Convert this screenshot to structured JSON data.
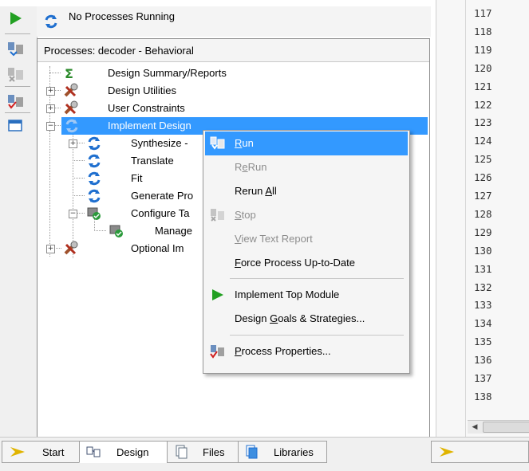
{
  "status": {
    "text": "No Processes Running"
  },
  "processes": {
    "title": "Processes: decoder - Behavioral",
    "tree": [
      {
        "label": "Design Summary/Reports",
        "icon": "sigma-icon"
      },
      {
        "label": "Design Utilities",
        "icon": "tools-icon"
      },
      {
        "label": "User Constraints",
        "icon": "tools-icon"
      },
      {
        "label": "Implement Design",
        "icon": "process-arrows-icon",
        "selected": true
      },
      {
        "label": "Synthesize -",
        "icon": "process-arrows-icon"
      },
      {
        "label": "Translate",
        "icon": "process-arrows-icon"
      },
      {
        "label": "Fit",
        "icon": "process-arrows-icon"
      },
      {
        "label": "Generate Pro",
        "icon": "process-arrows-icon"
      },
      {
        "label": "Configure Ta",
        "icon": "device-config-icon"
      },
      {
        "label": "Manage",
        "icon": "device-config-icon"
      },
      {
        "label": "Optional Im",
        "icon": "tools-icon"
      }
    ]
  },
  "context_menu": {
    "items": [
      {
        "pre": "",
        "key": "R",
        "post": "un",
        "state": "highlight"
      },
      {
        "pre": "R",
        "key": "e",
        "post": "Run",
        "state": "disabled"
      },
      {
        "pre": "Rerun ",
        "key": "A",
        "post": "ll",
        "state": "enabled"
      },
      {
        "pre": "",
        "key": "S",
        "post": "top",
        "state": "disabled"
      },
      {
        "pre": "",
        "key": "V",
        "post": "iew Text Report",
        "state": "disabled"
      },
      {
        "pre": "",
        "key": "F",
        "post": "orce Process Up-to-Date",
        "state": "enabled"
      },
      {
        "pre": "Implement Top Module",
        "key": "",
        "post": "",
        "state": "enabled"
      },
      {
        "pre": "Design ",
        "key": "G",
        "post": "oals & Strategies...",
        "state": "enabled"
      },
      {
        "pre": "",
        "key": "P",
        "post": "rocess Properties...",
        "state": "enabled"
      }
    ]
  },
  "tabs": [
    {
      "label": "Start",
      "active": false
    },
    {
      "label": "Design",
      "active": true
    },
    {
      "label": "Files",
      "active": false
    },
    {
      "label": "Libraries",
      "active": false
    }
  ],
  "line_numbers": [
    "117",
    "118",
    "119",
    "120",
    "121",
    "122",
    "123",
    "124",
    "125",
    "126",
    "127",
    "128",
    "129",
    "130",
    "131",
    "132",
    "133",
    "134",
    "135",
    "136",
    "137",
    "138"
  ],
  "colors": {
    "selection": "#3399ff",
    "run_green": "#22a022",
    "process_blue": "#1f6fcf"
  }
}
